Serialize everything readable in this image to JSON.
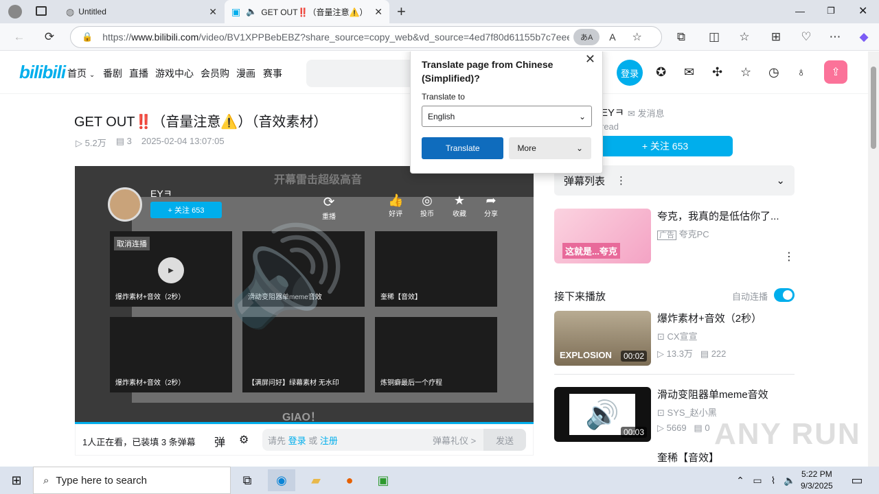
{
  "browser": {
    "tab1_title": "Untitled",
    "tab2_title": "GET OUT‼️（音量注意⚠️）",
    "url_prefix": "https://",
    "url_host": "www.bilibili.com",
    "url_rest": "/video/BV1XPPBebEBZ?share_source=copy_web&vd_source=4ed7f80d61155b7c7eee..."
  },
  "header": {
    "nav": [
      "首页",
      "番剧",
      "直播",
      "游戏中心",
      "会员购",
      "漫画",
      "赛事"
    ],
    "login": "登录"
  },
  "video": {
    "title": "GET OUT‼️（音量注意⚠️）（音效素材）",
    "views": "5.2万",
    "danmaku": "3",
    "date": "2025-02-04 13:07:05"
  },
  "player": {
    "overlay_text": "开幕雷击超级高音",
    "uploader": "EYㅋ",
    "follow": "+ 关注 653",
    "replay": "重播",
    "like": "好评",
    "coin": "投币",
    "fav": "收藏",
    "share": "分享",
    "cancel_autoplay": "取消连播",
    "tiles": [
      "爆炸素材+音效（2秒）",
      "滑动变阻器单meme音效",
      "奎稀【音效】",
      "爆炸素材+音效（2秒）",
      "【满屏问好】绿幕素材 无水印",
      "炼铜癖最后一个疗程"
    ],
    "giao": "GIAO！"
  },
  "danmubar": {
    "watching": "1人正在看，已装填 3 条弹幕",
    "input_prefix": "请先",
    "login": "登录",
    "or": "或",
    "register": "注册",
    "etiquette": "弹幕礼仪 >",
    "send": "发送"
  },
  "right": {
    "uploader": "EYㅋ",
    "message": "发消息",
    "read": "read",
    "follow": "+ 关注 653",
    "danmu_list": "弹幕列表",
    "ad_title": "夸克，我真的是低估你了...",
    "ad_label": "广告",
    "ad_source": "夸克PC",
    "next_label": "接下来播放",
    "autoplay": "自动连播",
    "v1_title": "爆炸素材+音效（2秒）",
    "v1_up": "CX宣宣",
    "v1_views": "13.3万",
    "v1_danmu": "222",
    "v1_dur": "00:02",
    "v1_thumb_text": "EXPLOSION",
    "v2_title": "滑动变阻器单meme音效",
    "v2_up": "SYS_赵小黑",
    "v2_views": "5669",
    "v2_danmu": "0",
    "v2_dur": "00:03",
    "v3_title": "奎稀【音效】",
    "ad_thumb_text": "这就是...夸克"
  },
  "translate": {
    "heading": "Translate page from Chinese (Simplified)?",
    "to_label": "Translate to",
    "language": "English",
    "translate_btn": "Translate",
    "more_btn": "More"
  },
  "taskbar": {
    "search": "Type here to search",
    "time": "5:22 PM",
    "date": "9/3/2025"
  },
  "watermark": "ANY RUN"
}
